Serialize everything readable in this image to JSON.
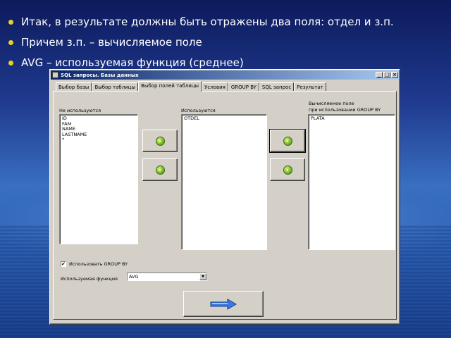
{
  "bullets": [
    "Итак, в результате должны быть отражены два поля: отдел и з.п.",
    "Причем з.п. – вычисляемое поле",
    "AVG – используемая функция (среднее)"
  ],
  "window": {
    "title": "SQL запросы. Базы данных",
    "minimize": "_",
    "maximize": "□",
    "close": "×"
  },
  "tabs": [
    "Выбор базы",
    "Выбор таблицы",
    "Выбор полей таблицы",
    "Условия",
    "GROUP BY",
    "SQL запрос",
    "Результат"
  ],
  "active_tab": "Выбор полей таблицы",
  "unused": {
    "label": "Не используются",
    "items": [
      "ID",
      "FAM",
      "NAME",
      "LASTNAME",
      "*"
    ]
  },
  "used": {
    "label": "Используются",
    "items": [
      "OTDEL"
    ]
  },
  "computed": {
    "label_line1": "Вычисляемое поле",
    "label_line2": "при использовании GROUP BY",
    "items": [
      "PLATA"
    ]
  },
  "icons": {
    "move_right": "arrow-right-icon",
    "move_left": "arrow-left-icon",
    "next": "next-arrow-icon"
  },
  "group_by": {
    "label": "Использовать GROUP BY",
    "checked": true,
    "mark": "✔"
  },
  "function": {
    "label": "Используемая функция",
    "value": "AVG",
    "dropdown_glyph": "▼"
  },
  "colors": {
    "bullet": "#e8d02a",
    "titlebar_start": "#0a246a",
    "titlebar_end": "#a6caf0",
    "window_face": "#d4d0c8",
    "next_arrow": "#3a7ae0"
  }
}
